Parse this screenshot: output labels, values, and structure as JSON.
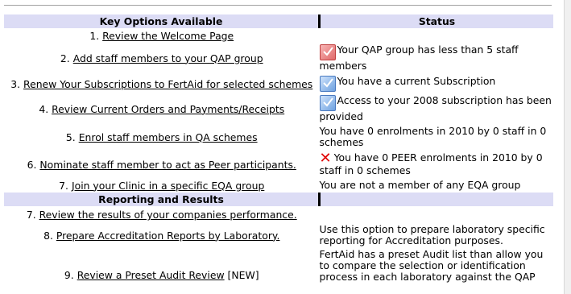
{
  "headers": {
    "options": "Key Options Available",
    "status": "Status"
  },
  "options": [
    {
      "num": "1.",
      "label": "Review the Welcome Page",
      "status": "",
      "icon": ""
    },
    {
      "num": "2.",
      "label": "Add staff members to your QAP group",
      "status": "Your QAP group has less than 5 staff members",
      "icon": "red-check-icon"
    },
    {
      "num": "3.",
      "label": "Renew Your Subscriptions to FertAid for selected schemes",
      "status": "You have a current Subscription",
      "icon": "blue-check-icon"
    },
    {
      "num": "4.",
      "label": "Review Current Orders and Payments/Receipts",
      "status": "Access to your 2008 subscription has been provided",
      "icon": "blue-check-icon"
    },
    {
      "num": "5.",
      "label": "Enrol staff members in QA schemes",
      "status": "You have 0 enrolments in 2010 by 0 staff in 0 schemes",
      "icon": ""
    },
    {
      "num": "6.",
      "label": "Nominate staff member to act as Peer participants.",
      "status": "You have 0 PEER enrolments in 2010 by 0 staff in 0 schemes",
      "icon": "red-x-icon"
    },
    {
      "num": "7.",
      "label": "Join your Clinic in a specific EQA group",
      "status": "You are not a member of any EQA group",
      "icon": ""
    }
  ],
  "section": {
    "title": "Reporting and Results"
  },
  "reports": [
    {
      "num": "7.",
      "label": "Review the results of your companies performance.",
      "status": ""
    },
    {
      "num": "8.",
      "label": "Prepare Accreditation Reports by Laboratory.",
      "status": "Use this option to prepare laboratory specific reporting for Accreditation purposes."
    },
    {
      "num": "9.",
      "label": "Review a Preset Audit Review",
      "suffix": "[NEW]",
      "status": "FertAid has a preset Audit list than allow you to compare the selection or identification process in each laboratory against the QAP"
    }
  ],
  "colors": {
    "header_bg": "#dcdcf5",
    "x_mark": "#e00000"
  }
}
